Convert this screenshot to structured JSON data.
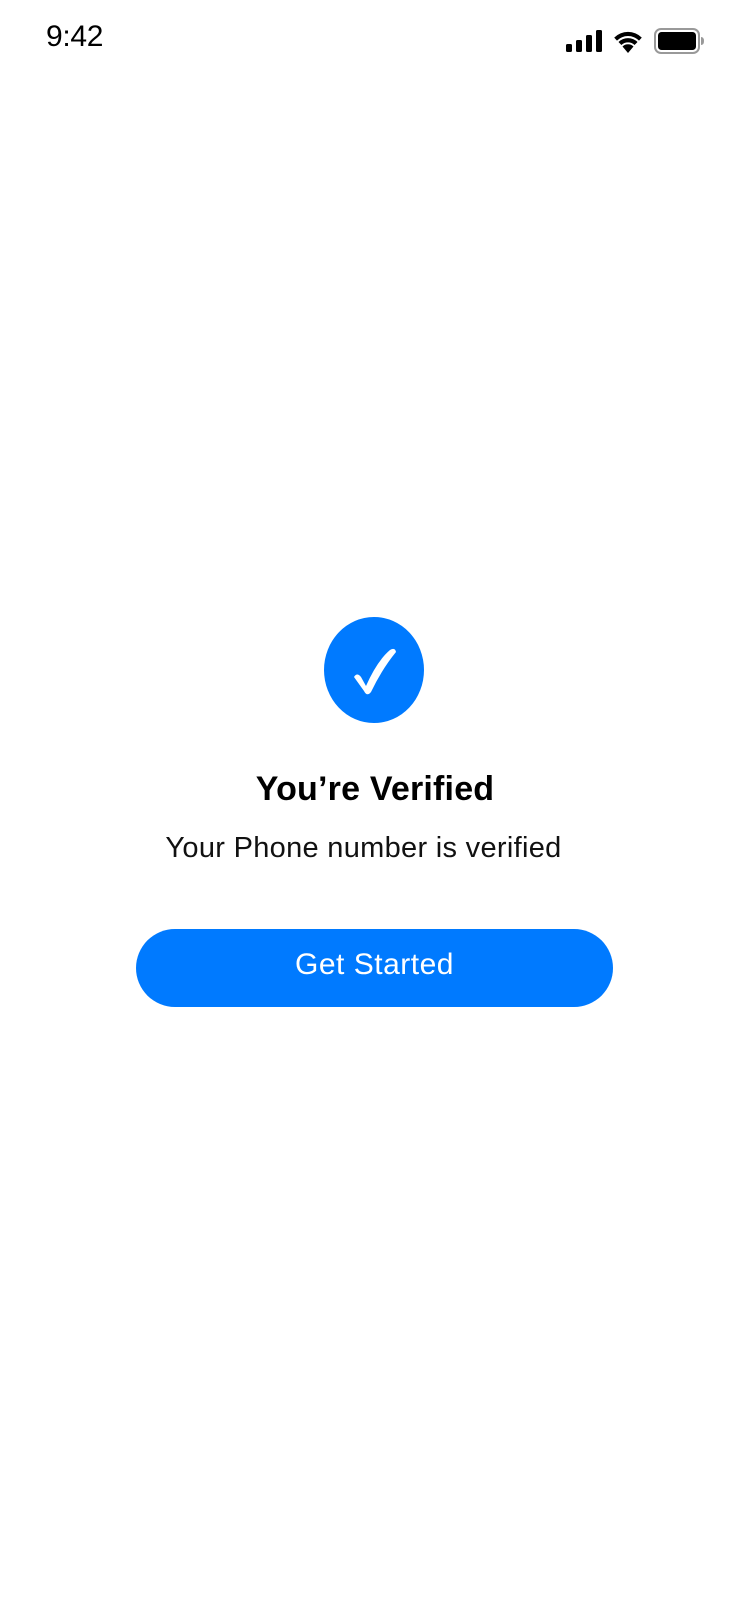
{
  "status_bar": {
    "time": "9:42",
    "icons": [
      "cellular-signal-icon",
      "wifi-icon",
      "battery-icon"
    ]
  },
  "verification": {
    "icon": "checkmark-circle-icon",
    "title": "You’re Verified",
    "subtitle": "Your Phone number is verified",
    "button_label": "Get Started"
  },
  "colors": {
    "accent": "#007aff",
    "background": "#ffffff",
    "text": "#000000"
  }
}
